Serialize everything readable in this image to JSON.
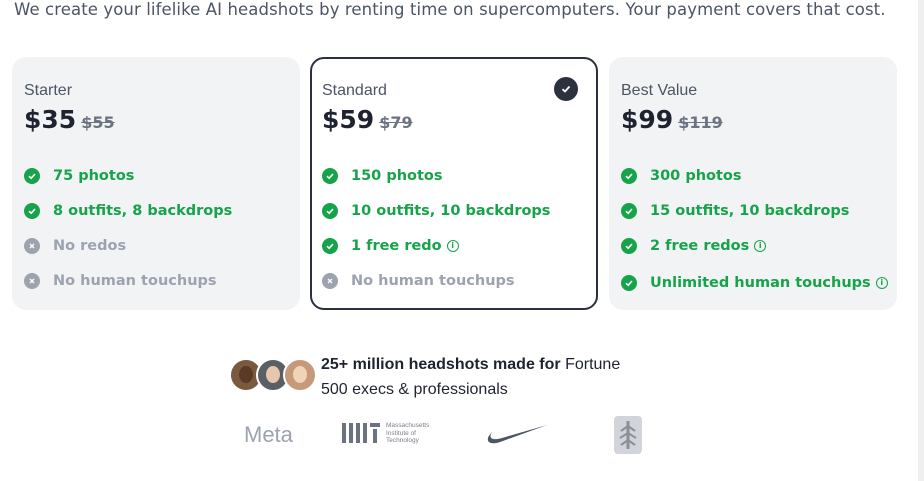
{
  "intro": "We create your lifelike AI headshots by renting time on supercomputers. Your payment covers that cost.",
  "plans": [
    {
      "name": "Starter",
      "price": "$35",
      "old_price": "$55",
      "features": [
        {
          "text": "75 photos",
          "included": true,
          "info": false
        },
        {
          "text": "8 outfits, 8 backdrops",
          "included": true,
          "info": false
        },
        {
          "text": "No redos",
          "included": false,
          "info": false
        },
        {
          "text": "No human touchups",
          "included": false,
          "info": false
        }
      ]
    },
    {
      "name": "Standard",
      "price": "$59",
      "old_price": "$79",
      "selected": true,
      "features": [
        {
          "text": "150 photos",
          "included": true,
          "info": false
        },
        {
          "text": "10 outfits, 10 backdrops",
          "included": true,
          "info": false
        },
        {
          "text": "1 free redo",
          "included": true,
          "info": true
        },
        {
          "text": "No human touchups",
          "included": false,
          "info": false
        }
      ]
    },
    {
      "name": "Best Value",
      "price": "$99",
      "old_price": "$119",
      "features": [
        {
          "text": "300 photos",
          "included": true,
          "info": false
        },
        {
          "text": "15 outfits, 10 backdrops",
          "included": true,
          "info": false
        },
        {
          "text": "2 free redos",
          "included": true,
          "info": true
        },
        {
          "text": "Unlimited human touchups",
          "included": true,
          "info": true
        }
      ]
    }
  ],
  "social_proof": {
    "bold": "25+ million headshots made for",
    "rest_line1": "Fortune",
    "line2": "500 execs & professionals"
  },
  "logos": {
    "meta": "Meta",
    "mit_lines": [
      "Massachusetts",
      "Institute of",
      "Technology"
    ]
  },
  "colors": {
    "accent": "#16a34a",
    "muted": "#9ca3af",
    "selected_border": "#2c3140"
  }
}
